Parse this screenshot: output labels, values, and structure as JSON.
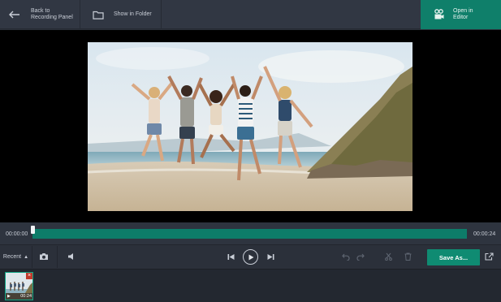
{
  "toolbar": {
    "back_label": "Back to\nRecording Panel",
    "folder_label": "Show in Folder",
    "editor_label": "Open in\nEditor"
  },
  "timeline": {
    "start_time": "00:00:00",
    "end_time": "00:00:24",
    "playhead_fraction": 0.0
  },
  "controls": {
    "recent_label": "Recent",
    "save_label": "Save As..."
  },
  "recent_items": [
    {
      "duration": "00:24"
    }
  ],
  "colors": {
    "accent": "#0f8b72",
    "track": "#0d7c69",
    "background": "#2b303a"
  },
  "icons": [
    "back-arrow-icon",
    "folder-icon",
    "film-editor-icon",
    "camera-icon",
    "volume-icon",
    "skip-previous-icon",
    "play-icon",
    "skip-next-icon",
    "undo-icon",
    "redo-icon",
    "scissors-icon",
    "trash-icon",
    "share-icon",
    "close-icon"
  ]
}
